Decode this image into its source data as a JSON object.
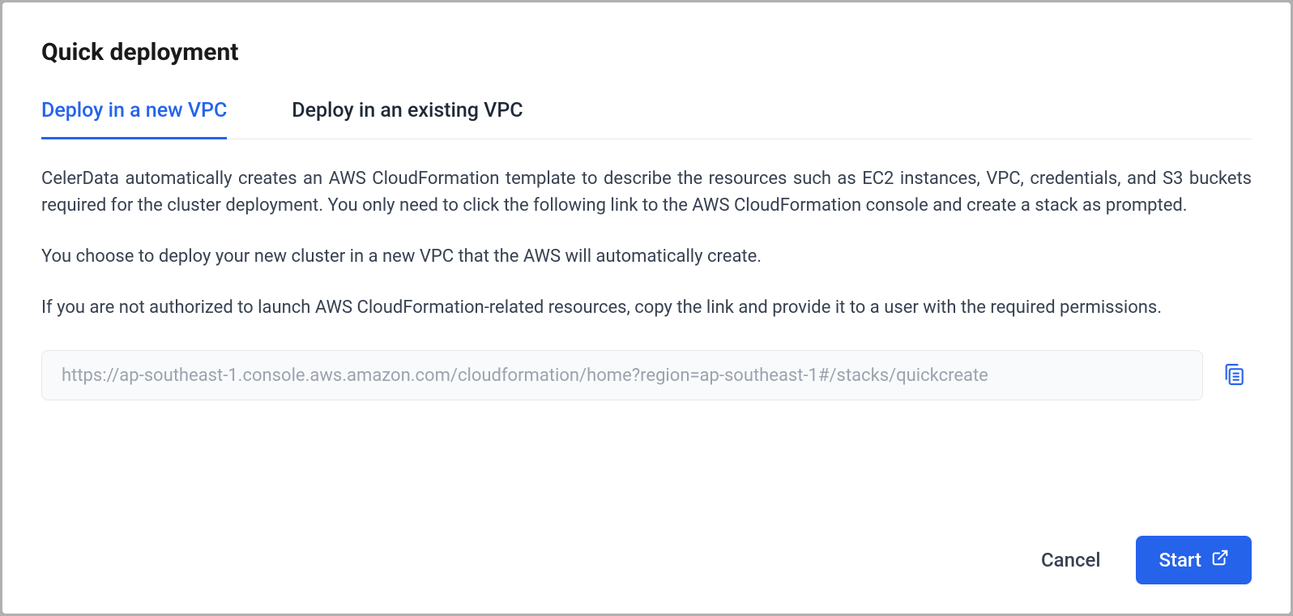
{
  "modal": {
    "title": "Quick deployment"
  },
  "tabs": {
    "new_vpc": "Deploy in a new VPC",
    "existing_vpc": "Deploy in an existing VPC"
  },
  "description": {
    "p1": "CelerData automatically creates an AWS CloudFormation template to describe the resources such as EC2 instances, VPC, credentials, and S3 buckets required for the cluster deployment. You only need to click the following link to the AWS CloudFormation console and create a stack as prompted.",
    "p2": "You choose to deploy your new cluster in a new VPC that the AWS will automatically create.",
    "p3": "If you are not authorized to launch AWS CloudFormation-related resources, copy the link and provide it to a user with the required permissions."
  },
  "url": {
    "value": "https://ap-southeast-1.console.aws.amazon.com/cloudformation/home?region=ap-southeast-1#/stacks/quickcreate"
  },
  "footer": {
    "cancel": "Cancel",
    "start": "Start"
  },
  "colors": {
    "primary": "#2563eb"
  }
}
